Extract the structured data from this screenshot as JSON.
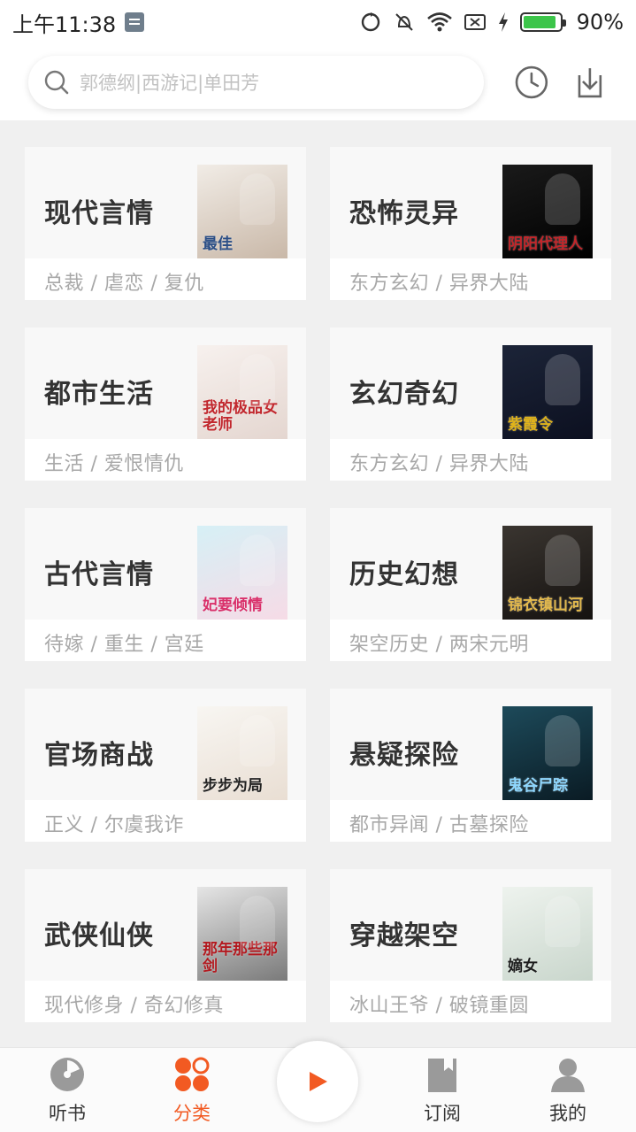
{
  "statusbar": {
    "time": "上午11:38",
    "battery_level": 0.9,
    "battery_text": "90%",
    "accent_battery": "#3cc54a"
  },
  "search": {
    "placeholder": "郭德纲|西游记|单田芳",
    "icon": "search-icon"
  },
  "header_icons": [
    "history-icon",
    "download-icon"
  ],
  "categories": [
    {
      "name": "现代言情",
      "tags": "总裁 / 虐恋 / 复仇",
      "cover_text": "最佳",
      "cover_bg": [
        "#f1ece6",
        "#c9b8a8"
      ],
      "cover_text_color": "#2b4e86"
    },
    {
      "name": "恐怖灵异",
      "tags": "东方玄幻 / 异界大陆",
      "cover_text": "阴阳代理人",
      "cover_bg": [
        "#1a1a1a",
        "#000000"
      ],
      "cover_text_color": "#c2262a"
    },
    {
      "name": "都市生活",
      "tags": "生活 / 爱恨情仇",
      "cover_text": "我的极品女老师",
      "cover_bg": [
        "#f7f1ee",
        "#e4d6d0"
      ],
      "cover_text_color": "#c1272d"
    },
    {
      "name": "玄幻奇幻",
      "tags": "东方玄幻 / 异界大陆",
      "cover_text": "紫霞令",
      "cover_bg": [
        "#1c2438",
        "#0c1020"
      ],
      "cover_text_color": "#e0b31a"
    },
    {
      "name": "古代言情",
      "tags": "待嫁 / 重生 / 宫廷",
      "cover_text": "妃要倾情",
      "cover_bg": [
        "#d6f0f6",
        "#f6dbe6"
      ],
      "cover_text_color": "#d9306a"
    },
    {
      "name": "历史幻想",
      "tags": "架空历史 / 两宋元明",
      "cover_text": "锦衣镇山河",
      "cover_bg": [
        "#3a3530",
        "#151210"
      ],
      "cover_text_color": "#e3b94c"
    },
    {
      "name": "官场商战",
      "tags": "正义 / 尔虞我诈",
      "cover_text": "步步为局",
      "cover_bg": [
        "#f8f6f2",
        "#e9ded3"
      ],
      "cover_text_color": "#222222"
    },
    {
      "name": "悬疑探险",
      "tags": "都市异闻 / 古墓探险",
      "cover_text": "鬼谷尸踪",
      "cover_bg": [
        "#1d4a5a",
        "#0a1b24"
      ],
      "cover_text_color": "#8fd8ff"
    },
    {
      "name": "武侠仙侠",
      "tags": "现代修身 / 奇幻修真",
      "cover_text": "那年那些那剑",
      "cover_bg": [
        "#e5e5e5",
        "#7a7a7a"
      ],
      "cover_text_color": "#b3191f"
    },
    {
      "name": "穿越架空",
      "tags": "冰山王爷 / 破镜重圆",
      "cover_text": "嫡女",
      "cover_bg": [
        "#eef3ee",
        "#c9d6cc"
      ],
      "cover_text_color": "#1d1d1d"
    }
  ],
  "bottom_nav": [
    {
      "label": "听书",
      "icon": "vinyl-disc-icon",
      "active": false
    },
    {
      "label": "分类",
      "icon": "category-grid-icon",
      "active": true
    },
    {
      "label": "订阅",
      "icon": "bookmark-book-icon",
      "active": false
    },
    {
      "label": "我的",
      "icon": "user-icon",
      "active": false
    }
  ],
  "play_button": {
    "icon": "play-icon"
  },
  "colors": {
    "accent": "#f25a22",
    "inactive_icon": "#9a9a9a",
    "tag_text": "#a8a8a8"
  }
}
